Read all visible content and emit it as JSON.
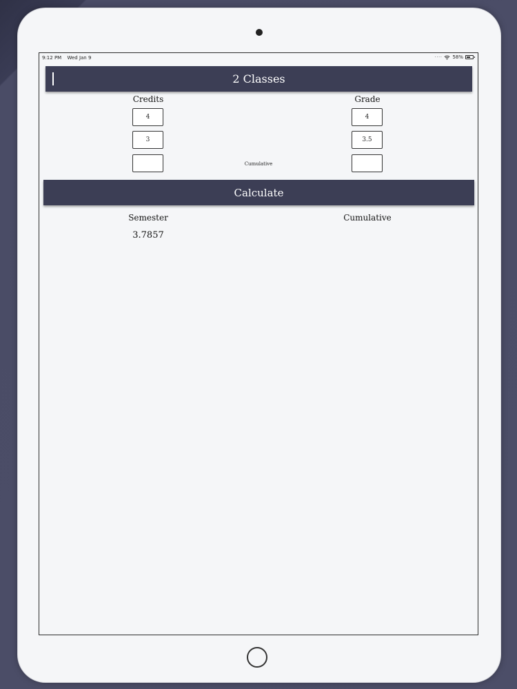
{
  "status_bar": {
    "time": "9:12 PM",
    "date": "Wed Jan 9",
    "battery": "58%",
    "battery_level": 0.58
  },
  "header": {
    "title": "2 Classes"
  },
  "columns": {
    "credits_label": "Credits",
    "grade_label": "Grade"
  },
  "rows": [
    {
      "credits": "4",
      "grade": "4"
    },
    {
      "credits": "3",
      "grade": "3.5"
    },
    {
      "credits": "",
      "grade": ""
    }
  ],
  "cumulative_label": "Cumulative",
  "calculate_label": "Calculate",
  "results": {
    "semester_label": "Semester",
    "semester_value": "3.7857",
    "cumulative_label": "Cumulative",
    "cumulative_value": ""
  },
  "colors": {
    "bar": "#3c3e55",
    "background": "#44465f",
    "screen": "#f5f6f8"
  }
}
